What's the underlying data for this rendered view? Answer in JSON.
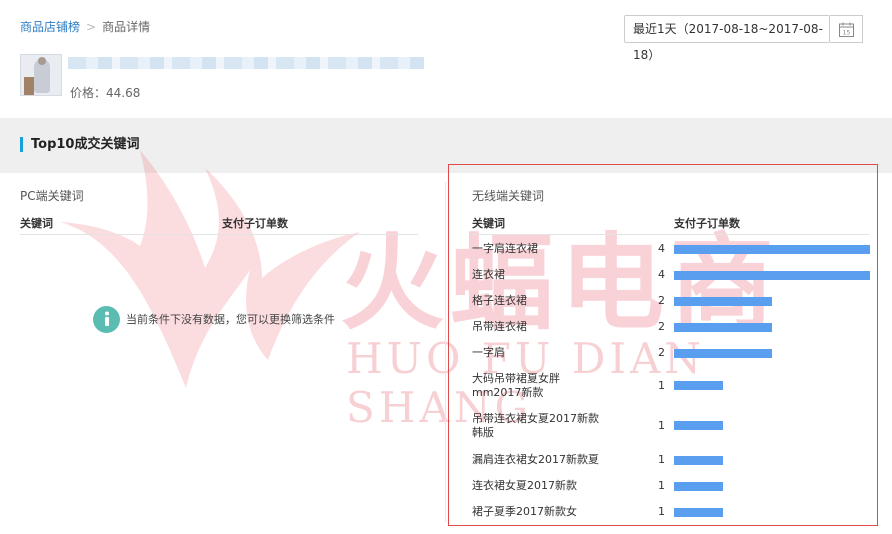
{
  "breadcrumb": {
    "root": "商品店铺榜",
    "separator": ">",
    "current": "商品详情"
  },
  "product": {
    "price_label": "价格：44.68"
  },
  "date_range": {
    "label": "最近1天（2017-08-18~2017-08-18）",
    "calendar_day": "15"
  },
  "section": {
    "title": "Top10成交关键词"
  },
  "pc_panel": {
    "title": "PC端关键词",
    "columns": [
      "关键词",
      "支付子订单数"
    ],
    "empty_message": "当前条件下没有数据，您可以更换筛选条件"
  },
  "mobile_panel": {
    "title": "无线端关键词",
    "columns": [
      "关键词",
      "支付子订单数"
    ],
    "rows": [
      {
        "keyword": "一字肩连衣裙",
        "count": "4",
        "value": 4
      },
      {
        "keyword": "连衣裙",
        "count": "4",
        "value": 4
      },
      {
        "keyword": "格子连衣裙",
        "count": "2",
        "value": 2
      },
      {
        "keyword": "吊带连衣裙",
        "count": "2",
        "value": 2
      },
      {
        "keyword": "一字肩",
        "count": "2",
        "value": 2
      },
      {
        "keyword": "大码吊带裙夏女胖mm2017新款",
        "count": "1",
        "value": 1
      },
      {
        "keyword": "吊带连衣裙女夏2017新款韩版",
        "count": "1",
        "value": 1
      },
      {
        "keyword": "漏肩连衣裙女2017新款夏",
        "count": "1",
        "value": 1
      },
      {
        "keyword": "连衣裙女夏2017新款",
        "count": "1",
        "value": 1
      },
      {
        "keyword": "裙子夏季2017新款女",
        "count": "1",
        "value": 1
      }
    ],
    "max_value": 4
  },
  "watermark": {
    "chinese": "火蝠电商",
    "english": "HUO FU DIAN SHANG"
  },
  "colors": {
    "bar": "#5a9ef0",
    "accent": "#1aa0d8",
    "link": "#2b7cc4",
    "highlight": "#e04a4a",
    "info_icon": "#5bbcb2"
  }
}
